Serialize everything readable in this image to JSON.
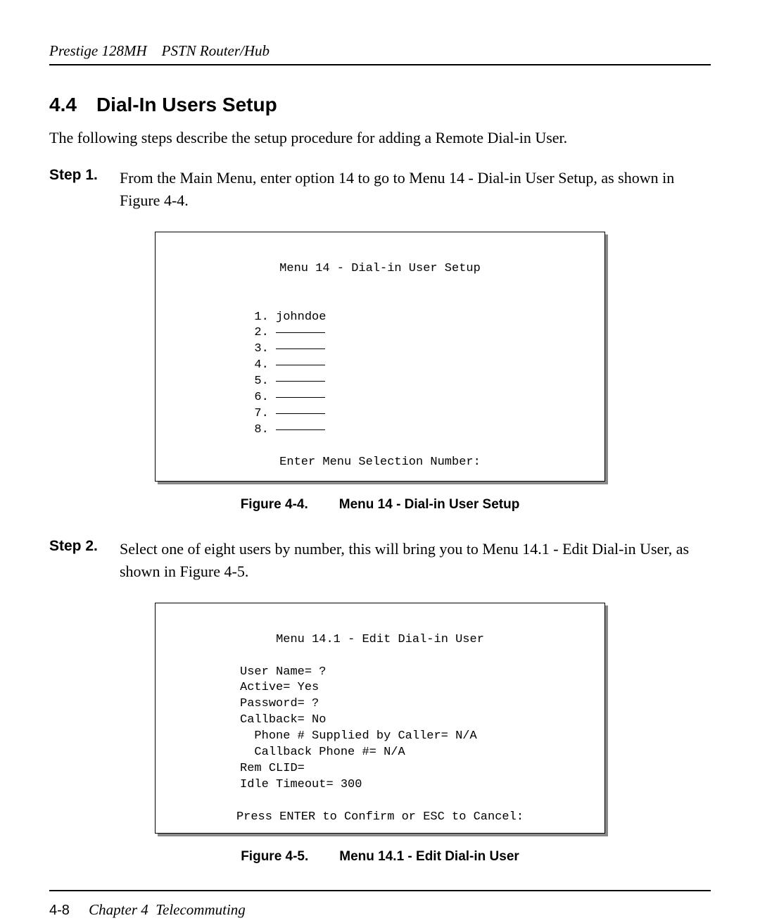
{
  "header": {
    "product": "Prestige 128MH",
    "subtitle": "PSTN Router/Hub"
  },
  "section": {
    "number": "4.4",
    "title": "Dial-In Users Setup",
    "intro": "The following steps describe the setup procedure for adding a Remote Dial-in User."
  },
  "step1": {
    "label": "Step 1.",
    "text": "From the Main Menu, enter option 14 to go to Menu 14 - Dial-in User Setup, as shown in Figure 4-4."
  },
  "figure1": {
    "title": "Menu 14 - Dial-in User Setup",
    "users": [
      "johndoe",
      "",
      "",
      "",
      "",
      "",
      "",
      ""
    ],
    "prompt": "Enter Menu Selection Number:",
    "caption_label": "Figure 4-4.",
    "caption_title": "Menu 14 - Dial-in User Setup"
  },
  "step2": {
    "label": "Step 2.",
    "text": "Select one of eight users by number, this will bring you to Menu 14.1 - Edit Dial-in User, as shown in Figure 4-5."
  },
  "figure2": {
    "title": "Menu 14.1 - Edit Dial-in User",
    "fields": {
      "user_name": "User Name= ?",
      "active": "Active= Yes",
      "password": "Password= ?",
      "callback": "Callback= No",
      "phone_supplied": "  Phone # Supplied by Caller= N/A",
      "callback_phone": "  Callback Phone #= N/A",
      "rem_clid": "Rem CLID=",
      "idle_timeout": "Idle Timeout= 300"
    },
    "prompt": "Press ENTER to Confirm or ESC to Cancel:",
    "caption_label": "Figure 4-5.",
    "caption_title": "Menu 14.1 - Edit Dial-in User"
  },
  "footer": {
    "page": "4-8",
    "chapter": "Chapter 4",
    "title": "Telecommuting"
  }
}
